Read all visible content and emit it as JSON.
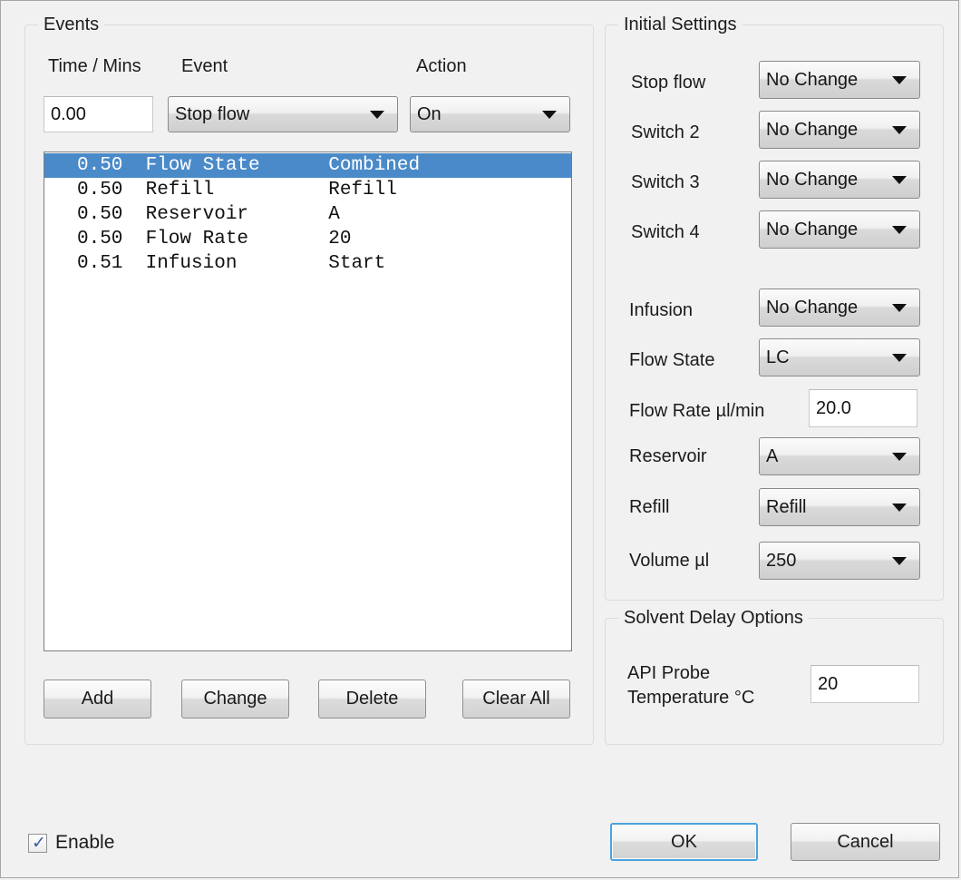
{
  "window": {
    "background": "#f1f1f1",
    "border_color": "#a6a6a6",
    "accent_color": "#4a8ac9",
    "focus_color": "#4aa3df"
  },
  "events_group": {
    "title": "Events",
    "column_headers": {
      "time": "Time / Mins",
      "event": "Event",
      "action": "Action"
    },
    "time_input": {
      "value": "0.00",
      "placeholder": "0.00"
    },
    "event_combo": {
      "value": "Stop flow"
    },
    "action_combo": {
      "value": "On"
    },
    "list_rows": [
      {
        "time": "0.50",
        "event": "Flow State",
        "action": "Combined",
        "selected": true
      },
      {
        "time": "0.50",
        "event": "Refill",
        "action": "Refill",
        "selected": false
      },
      {
        "time": "0.50",
        "event": "Reservoir",
        "action": "A",
        "selected": false
      },
      {
        "time": "0.50",
        "event": "Flow Rate",
        "action": "20",
        "selected": false
      },
      {
        "time": "0.51",
        "event": "Infusion",
        "action": "Start",
        "selected": false
      }
    ],
    "buttons": {
      "add": "Add",
      "change": "Change",
      "delete": "Delete",
      "clear_all": "Clear All"
    }
  },
  "initial_settings": {
    "title": "Initial Settings",
    "rows": [
      {
        "label": "Stop flow",
        "value": "No Change"
      },
      {
        "label": "Switch 2",
        "value": "No Change"
      },
      {
        "label": "Switch 3",
        "value": "No Change"
      },
      {
        "label": "Switch 4",
        "value": "No Change"
      },
      {
        "label": "Infusion",
        "value": "No Change"
      },
      {
        "label": "Flow State",
        "value": "LC"
      },
      {
        "label": "Reservoir",
        "value": "A"
      },
      {
        "label": "Refill",
        "value": "Refill"
      },
      {
        "label": "Volume µl",
        "value": "250"
      }
    ],
    "flow_rate": {
      "label": "Flow Rate µl/min",
      "value": "20.0"
    }
  },
  "solvent_delay": {
    "title": "Solvent Delay Options",
    "probe_label_line1": "API Probe",
    "probe_label_line2": "Temperature °C",
    "probe_value": "20"
  },
  "footer": {
    "enable_label": "Enable",
    "enable_checked": true,
    "check_glyph": "✓",
    "ok_label": "OK",
    "cancel_label": "Cancel"
  }
}
